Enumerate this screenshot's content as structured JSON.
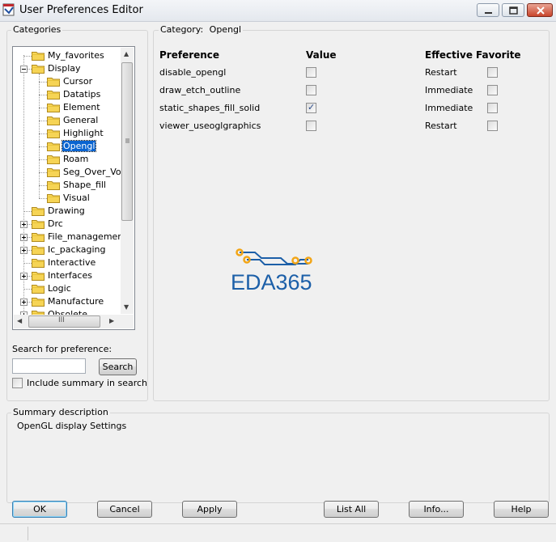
{
  "window": {
    "title": "User Preferences Editor"
  },
  "categories": {
    "legend": "Categories",
    "items": [
      {
        "label": "My_favorites",
        "expander": "none",
        "depth": 1,
        "selected": false
      },
      {
        "label": "Display",
        "expander": "minus",
        "depth": 1,
        "selected": false
      },
      {
        "label": "Cursor",
        "expander": "none",
        "depth": 2,
        "selected": false
      },
      {
        "label": "Datatips",
        "expander": "none",
        "depth": 2,
        "selected": false
      },
      {
        "label": "Element",
        "expander": "none",
        "depth": 2,
        "selected": false
      },
      {
        "label": "General",
        "expander": "none",
        "depth": 2,
        "selected": false
      },
      {
        "label": "Highlight",
        "expander": "none",
        "depth": 2,
        "selected": false
      },
      {
        "label": "Opengl",
        "expander": "none",
        "depth": 2,
        "selected": true
      },
      {
        "label": "Roam",
        "expander": "none",
        "depth": 2,
        "selected": false
      },
      {
        "label": "Seg_Over_Voi",
        "expander": "none",
        "depth": 2,
        "selected": false
      },
      {
        "label": "Shape_fill",
        "expander": "none",
        "depth": 2,
        "selected": false
      },
      {
        "label": "Visual",
        "expander": "none",
        "depth": 2,
        "selected": false
      },
      {
        "label": "Drawing",
        "expander": "none",
        "depth": 1,
        "selected": false
      },
      {
        "label": "Drc",
        "expander": "plus",
        "depth": 1,
        "selected": false
      },
      {
        "label": "File_management",
        "expander": "plus",
        "depth": 1,
        "selected": false
      },
      {
        "label": "Ic_packaging",
        "expander": "plus",
        "depth": 1,
        "selected": false
      },
      {
        "label": "Interactive",
        "expander": "none",
        "depth": 1,
        "selected": false
      },
      {
        "label": "Interfaces",
        "expander": "plus",
        "depth": 1,
        "selected": false
      },
      {
        "label": "Logic",
        "expander": "none",
        "depth": 1,
        "selected": false
      },
      {
        "label": "Manufacture",
        "expander": "plus",
        "depth": 1,
        "selected": false
      },
      {
        "label": "Obsolete",
        "expander": "plus",
        "depth": 1,
        "selected": false
      }
    ],
    "hscroll_glyph": "III"
  },
  "search": {
    "label": "Search for preference:",
    "value": "",
    "button_label": "Search",
    "include_summary_label": "Include summary in search",
    "include_summary_checked": false
  },
  "category_panel": {
    "category_prefix": "Category:",
    "category_name": "Opengl",
    "headers": {
      "preference": "Preference",
      "value": "Value",
      "effective": "Effective",
      "favorite": "Favorite"
    },
    "rows": [
      {
        "name": "disable_opengl",
        "value": false,
        "effective": "Restart",
        "favorite": false
      },
      {
        "name": "draw_etch_outline",
        "value": false,
        "effective": "Immediate",
        "favorite": false
      },
      {
        "name": "static_shapes_fill_solid",
        "value": true,
        "effective": "Immediate",
        "favorite": false
      },
      {
        "name": "viewer_useoglgraphics",
        "value": false,
        "effective": "Restart",
        "favorite": false
      }
    ]
  },
  "watermark": {
    "text": "EDA365",
    "color": "#1c5fa8",
    "accent": "#f2a516"
  },
  "summary": {
    "legend": "Summary description",
    "text": "OpenGL display Settings"
  },
  "buttons": {
    "ok": "OK",
    "cancel": "Cancel",
    "apply": "Apply",
    "list_all": "List All",
    "info": "Info...",
    "help": "Help"
  },
  "icons": {
    "app": "app-icon",
    "folder": "folder-icon",
    "minimize": "minimize-icon",
    "maximize": "maximize-icon",
    "close": "close-icon"
  },
  "colors": {
    "selection": "#0a64d0",
    "folder": "#f6d455"
  }
}
